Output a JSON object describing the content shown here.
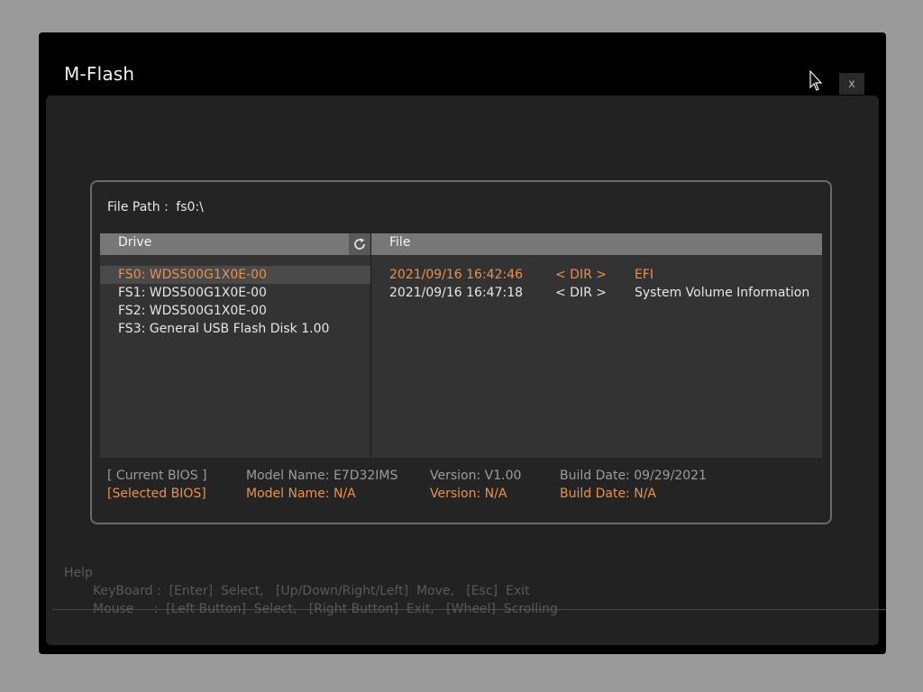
{
  "window": {
    "title": "M-Flash",
    "close_label": "x"
  },
  "file_path": {
    "label": "File Path :",
    "value": "fs0:\\"
  },
  "drive_pane": {
    "header": "Drive",
    "items": [
      {
        "label": "FS0: WDS500G1X0E-00",
        "selected": true
      },
      {
        "label": "FS1: WDS500G1X0E-00",
        "selected": false
      },
      {
        "label": "FS2: WDS500G1X0E-00",
        "selected": false
      },
      {
        "label": "FS3: General USB Flash Disk 1.00",
        "selected": false
      }
    ]
  },
  "file_pane": {
    "header": "File",
    "rows": [
      {
        "date": "2021/09/16 16:42:46",
        "type": "< DIR >",
        "name": "EFI",
        "active": true
      },
      {
        "date": "2021/09/16 16:47:18",
        "type": "< DIR >",
        "name": "System Volume Information",
        "active": false
      }
    ]
  },
  "bios": {
    "current": {
      "tag": "[ Current BIOS ]",
      "model": "Model Name: E7D32IMS",
      "version": "Version: V1.00",
      "build": "Build Date: 09/29/2021"
    },
    "selected": {
      "tag": "[Selected BIOS]",
      "model": "Model Name: N/A",
      "version": "Version: N/A",
      "build": "Build Date: N/A"
    }
  },
  "help": {
    "title": "Help",
    "keyboard": "KeyBoard :  [Enter]  Select,   [Up/Down/Right/Left]  Move,   [Esc]  Exit",
    "mouse": "Mouse     :  [Left Button]  Select,   [Right Button]  Exit,   [Wheel]  Scrolling"
  },
  "colors": {
    "accent": "#e8924a",
    "text": "#e6e6e6",
    "muted": "#9c9c9c"
  }
}
